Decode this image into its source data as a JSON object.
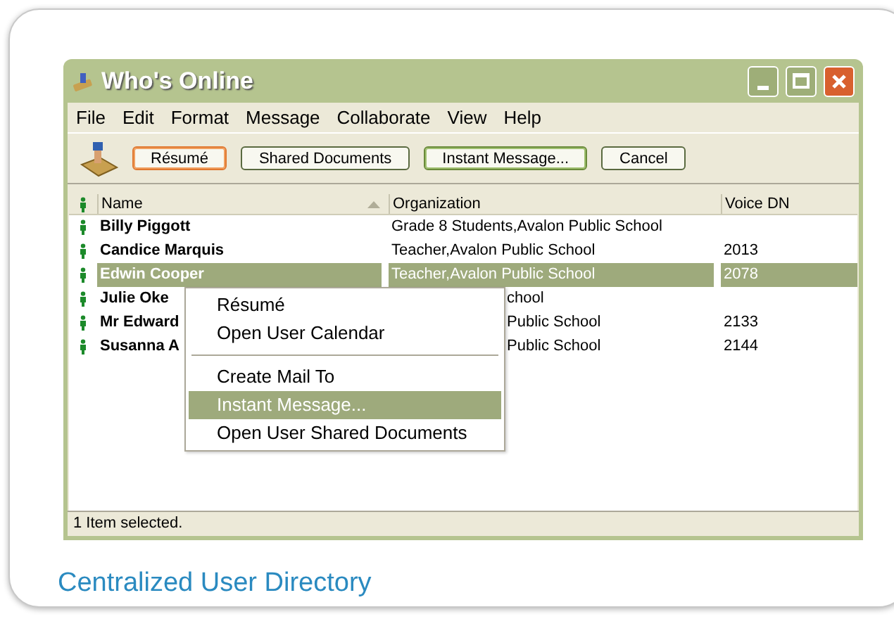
{
  "window": {
    "title": "Who's Online"
  },
  "menu_bar": [
    "File",
    "Edit",
    "Format",
    "Message",
    "Collaborate",
    "View",
    "Help"
  ],
  "toolbar": [
    {
      "label": "Résumé",
      "selected": true,
      "default": false
    },
    {
      "label": "Shared Documents",
      "selected": false,
      "default": false
    },
    {
      "label": "Instant Message...",
      "selected": false,
      "default": true
    },
    {
      "label": "Cancel",
      "selected": false,
      "default": false
    }
  ],
  "table": {
    "columns": [
      "Name",
      "Organization",
      "Voice DN"
    ],
    "rows": [
      {
        "name": "Billy Piggott",
        "organization": "Grade 8 Students,Avalon Public School",
        "voice_dn": "",
        "selected": false,
        "under_menu": false
      },
      {
        "name": "Candice Marquis",
        "organization": "Teacher,Avalon Public School",
        "voice_dn": "2013",
        "selected": false,
        "under_menu": false
      },
      {
        "name": "Edwin Cooper",
        "organization": "Teacher,Avalon Public School",
        "voice_dn": "2078",
        "selected": true,
        "under_menu": false
      },
      {
        "name": "Julie Oke",
        "organization": "chool",
        "voice_dn": "",
        "selected": false,
        "under_menu": true
      },
      {
        "name": "Mr Edward",
        "organization": "Public School",
        "voice_dn": "2133",
        "selected": false,
        "under_menu": true
      },
      {
        "name": "Susanna A",
        "organization": "Public School",
        "voice_dn": "2144",
        "selected": false,
        "under_menu": true
      }
    ]
  },
  "context_menu": [
    {
      "label": "Résumé",
      "selected": false,
      "kind": "item"
    },
    {
      "label": "Open User Calendar",
      "selected": false,
      "kind": "item"
    },
    {
      "kind": "separator"
    },
    {
      "label": "Create Mail To",
      "selected": false,
      "kind": "item"
    },
    {
      "label": "Instant Message...",
      "selected": true,
      "kind": "item"
    },
    {
      "label": "Open User Shared Documents",
      "selected": false,
      "kind": "item"
    }
  ],
  "status_bar": "1 Item selected.",
  "caption": "Centralized User Directory"
}
